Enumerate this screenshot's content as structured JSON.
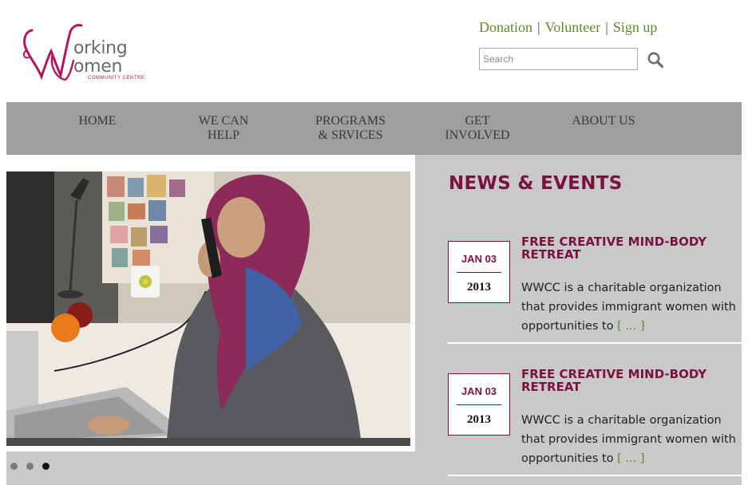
{
  "header": {
    "logo": {
      "line1": "orking",
      "line2": "omen",
      "line3": "COMMUNITY CENTRE",
      "brand_color": "#b5145b"
    },
    "links": [
      {
        "label": "Donation"
      },
      {
        "label": "Volunteer"
      },
      {
        "label": "Sign up"
      }
    ],
    "separator": "|",
    "search": {
      "placeholder": "Search",
      "value": "",
      "icon": "magnifier-icon"
    }
  },
  "nav": {
    "items": [
      {
        "line1": "HOME",
        "line2": ""
      },
      {
        "line1": "WE CAN",
        "line2": "HELP"
      },
      {
        "line1": "PROGRAMS",
        "line2": "& SRVICES"
      },
      {
        "line1": "GET",
        "line2": "INVOLVED"
      },
      {
        "line1": "ABOUT US",
        "line2": ""
      }
    ]
  },
  "slider": {
    "slide_count": 3,
    "active_index": 2
  },
  "news": {
    "heading": "NEWS & EVENTS",
    "events": [
      {
        "date": "JAN 03",
        "year": "2013",
        "title": "FREE CREATIVE MIND-BODY RETREAT",
        "description": "WWCC is a charitable organization that provides immigrant women with opportunities to",
        "more": "[ ... ]"
      },
      {
        "date": "JAN 03",
        "year": "2013",
        "title": "FREE CREATIVE MIND-BODY RETREAT",
        "description": "WWCC is a charitable organization that provides immigrant women with opportunities to",
        "more": "[ ... ]"
      }
    ]
  },
  "colors": {
    "accent": "#7a1240",
    "link_green": "#5f8a2c",
    "nav_bg": "#9e9e9e",
    "content_bg": "#c9c9c9"
  }
}
